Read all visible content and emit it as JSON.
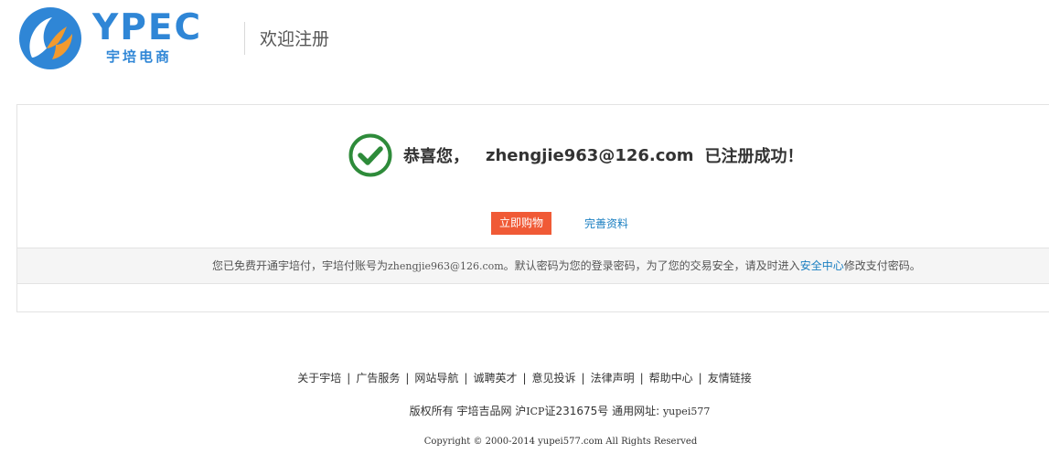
{
  "header": {
    "brand": "YPEC",
    "brand_sub": "宇培电商",
    "title": "欢迎注册",
    "colors": {
      "brand_blue": "#2f86d6",
      "brand_orange": "#f29a2e"
    }
  },
  "success": {
    "icon": "check-circle-icon",
    "congrats": "恭喜您，",
    "email": "zhengjie963@126.com",
    "suffix": "已注册成功！",
    "icon_color": "#2e8b3a"
  },
  "actions": {
    "shop_label": "立即购物",
    "complete_label": "完善资料",
    "shop_color": "#f05a36"
  },
  "notice": {
    "before": "您已免费开通宇培付，宇培付账号为",
    "account": "zhengjie963@126.com",
    "middle": "。默认密码为您的登录密码，为了您的交易安全，请及时进入",
    "link": "安全中心",
    "after": "修改支付密码。"
  },
  "footer": {
    "links": [
      "关于宇培",
      "广告服务",
      "网站导航",
      "诚聘英才",
      "意见投诉",
      "法律声明",
      "帮助中心",
      "友情链接"
    ],
    "separator": "|",
    "line2_a": "版权所有 宇培吉品网 沪",
    "line2_icp": "ICP",
    "line2_b": "证231675号 通用网址:",
    "line2_url": "yupei577",
    "copyright": "Copyright © 2000-2014 yupei577.com All Rights Reserved"
  }
}
